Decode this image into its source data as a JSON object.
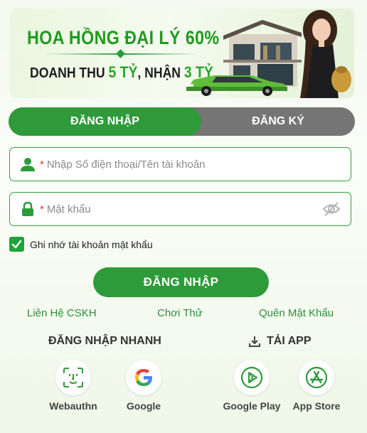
{
  "banner": {
    "title": "HOA HỒNG ĐẠI LÝ 60%",
    "subtitle_part1": "DOANH THU ",
    "subtitle_hl1": "5 TỶ",
    "subtitle_part2": ", NHẬN ",
    "subtitle_hl2": "3 TỶ"
  },
  "tabs": {
    "login": "ĐĂNG NHẬP",
    "register": "ĐĂNG KÝ"
  },
  "form": {
    "username_required": "*",
    "username_placeholder": "Nhập Số điện thoại/Tên tài khoản",
    "username_value": "",
    "password_required": "*",
    "password_placeholder": "Mật khẩu",
    "password_value": "",
    "remember_label": "Ghi nhớ tài khoản mật khẩu",
    "remember_checked": true,
    "submit_label": "ĐĂNG NHẬP"
  },
  "links": {
    "support": "Liên Hệ CSKH",
    "trial": "Chơi Thử",
    "forgot": "Quên Mật Khẩu"
  },
  "quick_login": {
    "title": "ĐĂNG NHẬP NHANH",
    "webauthn": "Webauthn",
    "google": "Google"
  },
  "download": {
    "title": "TẢI APP",
    "google_play": "Google Play",
    "app_store": "App Store"
  },
  "colors": {
    "primary_green": "#2f9a3a",
    "tab_inactive": "#757575",
    "required_red": "#e53935",
    "link_green": "#2e8f3b"
  },
  "icons": {
    "username": "user-icon",
    "password": "lock-icon",
    "toggle_password": "eye-slash-icon",
    "remember": "check-icon",
    "webauthn": "face-id-icon",
    "google": "google-icon",
    "download": "download-icon",
    "google_play": "play-store-icon",
    "app_store": "app-store-icon"
  }
}
